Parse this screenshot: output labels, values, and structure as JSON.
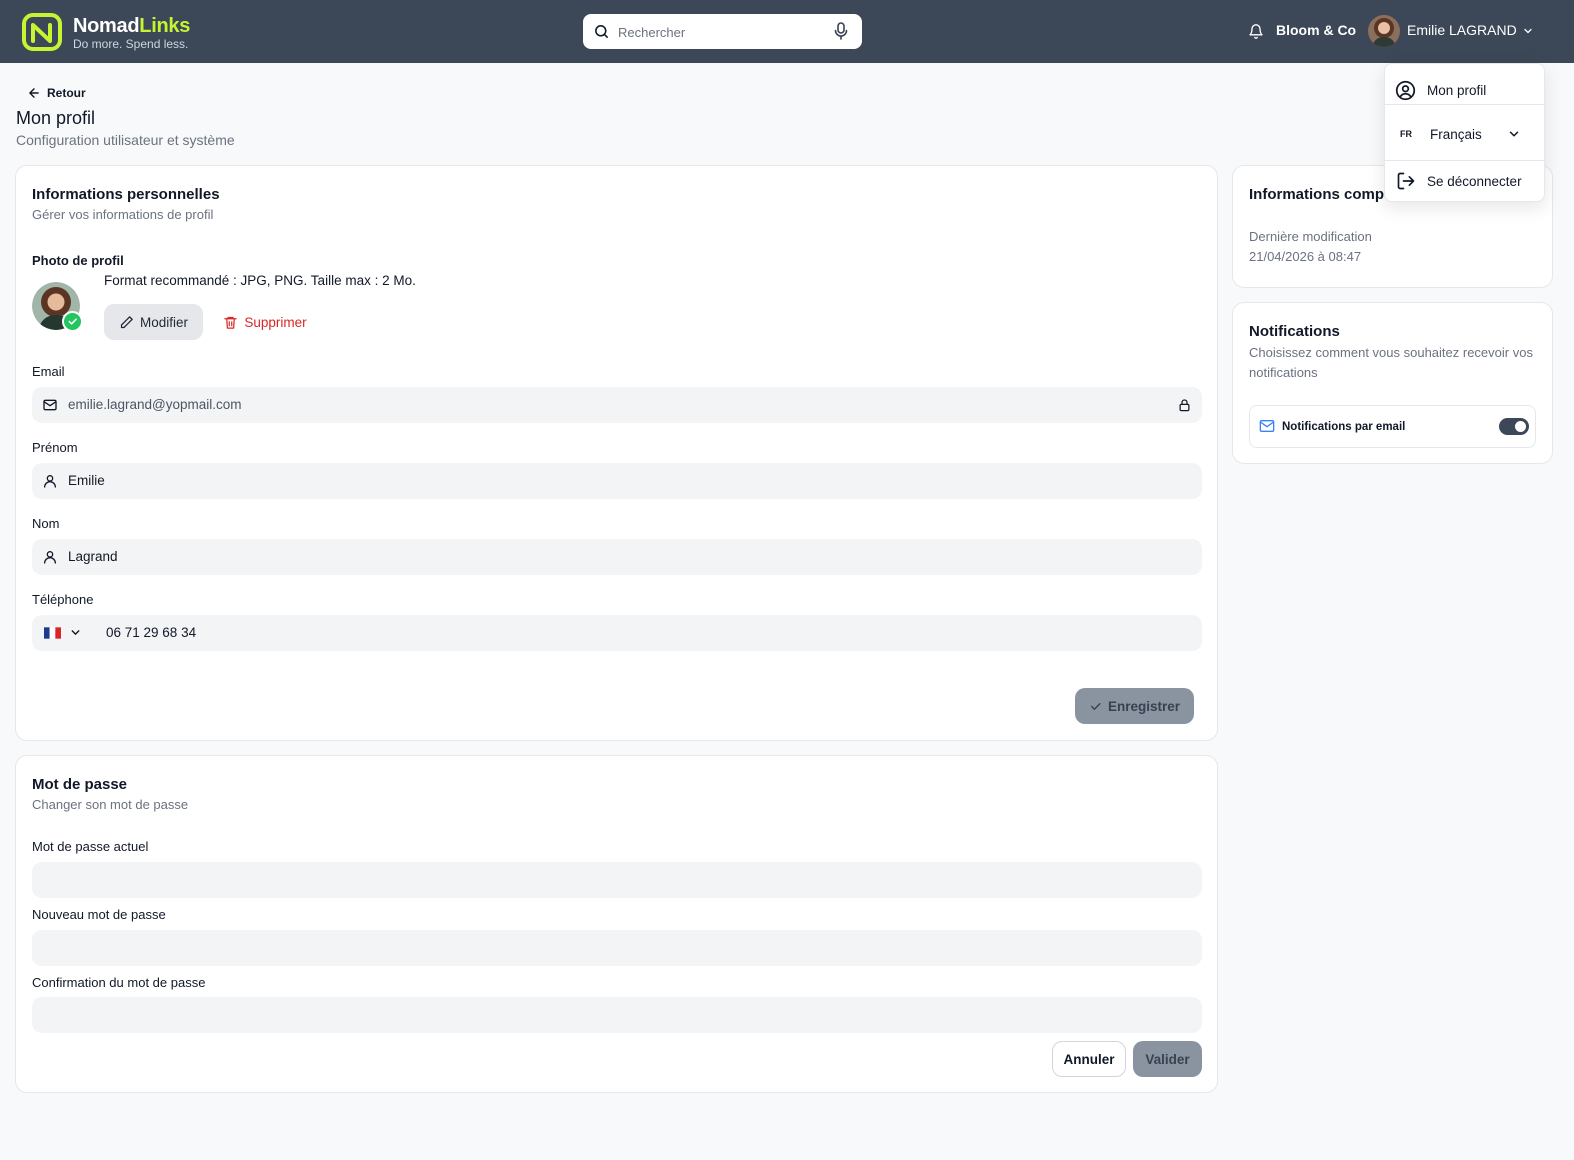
{
  "header": {
    "brand_name_a": "Nomad",
    "brand_name_b": "Links",
    "tagline": "Do more. Spend less.",
    "search_placeholder": "Rechercher",
    "company": "Bloom & Co",
    "user_name": "Emilie LAGRAND"
  },
  "page": {
    "back_label": "Retour",
    "title": "Mon profil",
    "subtitle": "Configuration utilisateur et système"
  },
  "personal": {
    "title": "Informations personnelles",
    "subtitle": "Gérer vos informations de profil",
    "photo_label": "Photo de profil",
    "photo_hint": "Format recommandé : JPG, PNG. Taille max : 2 Mo.",
    "modify_label": "Modifier",
    "delete_label": "Supprimer",
    "email_label": "Email",
    "email_value": "emilie.lagrand@yopmail.com",
    "firstname_label": "Prénom",
    "firstname_value": "Emilie",
    "lastname_label": "Nom",
    "lastname_value": "Lagrand",
    "phone_label": "Téléphone",
    "phone_value": "06 71 29 68 34",
    "save_label": "Enregistrer"
  },
  "password": {
    "title": "Mot de passe",
    "subtitle": "Changer son mot de passe",
    "current_label": "Mot de passe actuel",
    "new_label": "Nouveau mot de passe",
    "confirm_label": "Confirmation du mot de passe",
    "cancel_label": "Annuler",
    "submit_label": "Valider"
  },
  "info": {
    "title": "Informations comp",
    "last_modified_label": "Dernière modification",
    "last_modified_value": "21/04/2026 à 08:47"
  },
  "notifications": {
    "title": "Notifications",
    "subtitle": "Choisissez comment vous souhaitez recevoir vos notifications",
    "email_toggle_label": "Notifications par email",
    "email_toggle_on": true
  },
  "menu": {
    "profile_label": "Mon profil",
    "lang_code": "FR",
    "lang_label": "Français",
    "logout_label": "Se déconnecter"
  },
  "colors": {
    "topbar": "#3c4757",
    "brand_accent": "#c6f432",
    "danger": "#dc2626",
    "disabled_button": "#8a94a1",
    "success": "#22c55e"
  }
}
